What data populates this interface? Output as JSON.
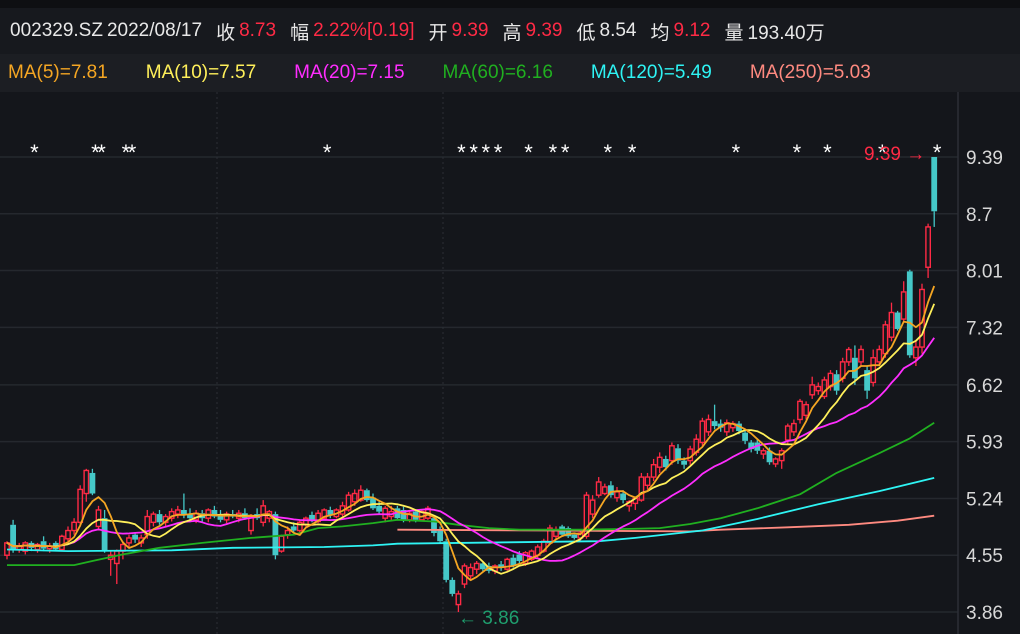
{
  "header": {
    "code": "002329.SZ",
    "date": "2022/08/17",
    "close_label": "收",
    "close": "8.73",
    "change_label": "幅",
    "change": "2.22%[0.19]",
    "open_label": "开",
    "open": "9.39",
    "high_label": "高",
    "high": "9.39",
    "low_label": "低",
    "low": "8.54",
    "avg_label": "均",
    "avg": "9.12",
    "volume_label": "量",
    "volume": "193.40万"
  },
  "ma_legend": [
    {
      "text": "MA(5)=7.81",
      "color": "#f5a623"
    },
    {
      "text": "MA(10)=7.57",
      "color": "#fff05a"
    },
    {
      "text": "MA(20)=7.15",
      "color": "#ff2dff"
    },
    {
      "text": "MA(60)=6.16",
      "color": "#20b020"
    },
    {
      "text": "MA(120)=5.49",
      "color": "#2ef4f4"
    },
    {
      "text": "MA(250)=5.03",
      "color": "#ff8a80"
    }
  ],
  "chart_data": {
    "type": "candlestick",
    "ylim": [
      3.86,
      9.39
    ],
    "y_ticks": [
      "9.39",
      "8.7",
      "8.01",
      "7.32",
      "6.62",
      "5.93",
      "5.24",
      "4.55",
      "3.86"
    ],
    "grid": true,
    "colors": {
      "up": "#ff2a45",
      "down": "#45c8c8",
      "max_label": "#ff2a45",
      "min_label": "#1f9e6e"
    },
    "max_label": "9.39",
    "min_label": "3.86",
    "star_marker": "*",
    "star_candles": [
      4,
      14,
      15,
      19,
      20,
      52,
      74,
      76,
      78,
      80,
      85,
      89,
      91,
      98,
      102,
      119,
      129,
      134,
      143,
      152
    ],
    "candles_ohlc": [
      [
        4.55,
        4.72,
        4.5,
        4.7
      ],
      [
        4.92,
        4.98,
        4.58,
        4.62
      ],
      [
        4.62,
        4.7,
        4.58,
        4.66
      ],
      [
        4.6,
        4.72,
        4.56,
        4.7
      ],
      [
        4.7,
        4.72,
        4.6,
        4.64
      ],
      [
        4.62,
        4.7,
        4.58,
        4.68
      ],
      [
        4.72,
        4.78,
        4.6,
        4.63
      ],
      [
        4.63,
        4.7,
        4.58,
        4.66
      ],
      [
        4.7,
        4.72,
        4.6,
        4.62
      ],
      [
        4.62,
        4.8,
        4.6,
        4.78
      ],
      [
        4.75,
        4.9,
        4.72,
        4.85
      ],
      [
        4.85,
        5.0,
        4.8,
        4.95
      ],
      [
        4.95,
        5.4,
        4.9,
        5.35
      ],
      [
        5.3,
        5.6,
        5.2,
        5.58
      ],
      [
        5.55,
        5.6,
        5.28,
        5.3
      ],
      [
        4.9,
        5.15,
        4.85,
        5.1
      ],
      [
        5.0,
        5.1,
        4.58,
        4.6
      ],
      [
        4.5,
        4.6,
        4.3,
        4.55
      ],
      [
        4.45,
        4.62,
        4.2,
        4.6
      ],
      [
        4.6,
        4.72,
        4.5,
        4.68
      ],
      [
        4.7,
        4.8,
        4.65,
        4.76
      ],
      [
        4.8,
        4.82,
        4.7,
        4.74
      ],
      [
        4.7,
        4.8,
        4.65,
        4.76
      ],
      [
        4.8,
        5.1,
        4.75,
        5.02
      ],
      [
        4.95,
        5.08,
        4.9,
        5.05
      ],
      [
        5.05,
        5.1,
        4.92,
        4.95
      ],
      [
        4.95,
        5.05,
        4.9,
        5.02
      ],
      [
        5.0,
        5.12,
        4.96,
        5.08
      ],
      [
        5.05,
        5.15,
        5.0,
        5.1
      ],
      [
        5.1,
        5.3,
        5.0,
        5.05
      ],
      [
        5.05,
        5.12,
        4.95,
        5.0
      ],
      [
        4.98,
        5.1,
        4.94,
        5.06
      ],
      [
        5.06,
        5.1,
        4.96,
        5.0
      ],
      [
        5.0,
        5.12,
        4.95,
        5.1
      ],
      [
        5.1,
        5.15,
        5.0,
        5.02
      ],
      [
        5.05,
        5.1,
        4.95,
        4.98
      ],
      [
        4.98,
        5.08,
        4.94,
        5.05
      ],
      [
        5.05,
        5.1,
        5.0,
        5.02
      ],
      [
        5.0,
        5.1,
        4.95,
        5.06
      ],
      [
        5.06,
        5.12,
        4.98,
        5.0
      ],
      [
        4.85,
        5.05,
        4.8,
        5.02
      ],
      [
        5.05,
        5.12,
        4.98,
        5.0
      ],
      [
        4.95,
        5.22,
        4.9,
        5.15
      ],
      [
        5.0,
        5.1,
        4.95,
        5.08
      ],
      [
        5.05,
        5.08,
        4.5,
        4.55
      ],
      [
        4.6,
        4.8,
        4.58,
        4.78
      ],
      [
        4.8,
        4.9,
        4.75,
        4.85
      ],
      [
        4.9,
        4.95,
        4.82,
        4.85
      ],
      [
        4.85,
        4.98,
        4.82,
        4.95
      ],
      [
        4.92,
        5.02,
        4.9,
        5.0
      ],
      [
        5.04,
        5.08,
        4.95,
        4.98
      ],
      [
        4.96,
        5.1,
        4.94,
        5.06
      ],
      [
        5.0,
        5.12,
        4.98,
        5.1
      ],
      [
        5.1,
        5.14,
        5.0,
        5.04
      ],
      [
        5.02,
        5.12,
        5.0,
        5.1
      ],
      [
        5.05,
        5.2,
        5.02,
        5.15
      ],
      [
        5.1,
        5.32,
        5.08,
        5.28
      ],
      [
        5.2,
        5.35,
        5.15,
        5.3
      ],
      [
        5.22,
        5.4,
        5.2,
        5.34
      ],
      [
        5.34,
        5.36,
        5.2,
        5.22
      ],
      [
        5.25,
        5.3,
        5.1,
        5.12
      ],
      [
        5.15,
        5.2,
        5.05,
        5.08
      ],
      [
        5.0,
        5.15,
        4.95,
        5.12
      ],
      [
        5.02,
        5.15,
        4.98,
        5.08
      ],
      [
        5.12,
        5.15,
        4.98,
        5.0
      ],
      [
        5.1,
        5.14,
        4.95,
        4.98
      ],
      [
        4.98,
        5.1,
        4.95,
        5.06
      ],
      [
        5.08,
        5.1,
        4.95,
        4.98
      ],
      [
        4.98,
        5.1,
        4.96,
        5.08
      ],
      [
        5.0,
        5.15,
        4.98,
        5.12
      ],
      [
        5.0,
        5.02,
        4.78,
        4.82
      ],
      [
        4.85,
        4.9,
        4.7,
        4.72
      ],
      [
        4.72,
        4.75,
        4.22,
        4.25
      ],
      [
        4.25,
        4.28,
        4.05,
        4.08
      ],
      [
        3.95,
        4.12,
        3.86,
        4.08
      ],
      [
        4.2,
        4.45,
        4.15,
        4.42
      ],
      [
        4.3,
        4.45,
        4.25,
        4.4
      ],
      [
        4.38,
        4.48,
        4.32,
        4.45
      ],
      [
        4.45,
        4.46,
        4.36,
        4.38
      ],
      [
        4.42,
        4.46,
        4.33,
        4.36
      ],
      [
        4.36,
        4.44,
        4.32,
        4.42
      ],
      [
        4.44,
        4.48,
        4.36,
        4.4
      ],
      [
        4.38,
        4.52,
        4.36,
        4.5
      ],
      [
        4.52,
        4.56,
        4.4,
        4.42
      ],
      [
        4.56,
        4.6,
        4.45,
        4.48
      ],
      [
        4.45,
        4.6,
        4.42,
        4.58
      ],
      [
        4.5,
        4.62,
        4.48,
        4.6
      ],
      [
        4.55,
        4.68,
        4.52,
        4.65
      ],
      [
        4.6,
        4.75,
        4.58,
        4.72
      ],
      [
        4.7,
        4.92,
        4.68,
        4.88
      ],
      [
        4.78,
        4.9,
        4.74,
        4.86
      ],
      [
        4.9,
        4.92,
        4.78,
        4.8
      ],
      [
        4.88,
        4.9,
        4.76,
        4.78
      ],
      [
        4.8,
        4.82,
        4.74,
        4.76
      ],
      [
        4.76,
        4.85,
        4.72,
        4.82
      ],
      [
        4.78,
        5.32,
        4.75,
        5.28
      ],
      [
        5.05,
        5.28,
        5.0,
        5.22
      ],
      [
        5.28,
        5.5,
        5.25,
        5.44
      ],
      [
        5.3,
        5.42,
        5.28,
        5.38
      ],
      [
        5.4,
        5.45,
        5.25,
        5.28
      ],
      [
        5.25,
        5.38,
        5.2,
        5.32
      ],
      [
        5.3,
        5.34,
        5.18,
        5.22
      ],
      [
        5.15,
        5.22,
        5.08,
        5.2
      ],
      [
        5.18,
        5.26,
        5.1,
        5.24
      ],
      [
        5.22,
        5.55,
        5.2,
        5.5
      ],
      [
        5.4,
        5.55,
        5.35,
        5.5
      ],
      [
        5.5,
        5.72,
        5.45,
        5.65
      ],
      [
        5.62,
        5.8,
        5.55,
        5.74
      ],
      [
        5.72,
        5.76,
        5.58,
        5.62
      ],
      [
        5.7,
        5.92,
        5.65,
        5.88
      ],
      [
        5.85,
        5.9,
        5.66,
        5.7
      ],
      [
        5.7,
        5.74,
        5.6,
        5.65
      ],
      [
        5.7,
        5.88,
        5.65,
        5.84
      ],
      [
        5.8,
        6.02,
        5.76,
        5.96
      ],
      [
        5.92,
        6.22,
        5.88,
        6.18
      ],
      [
        6.05,
        6.26,
        6.0,
        6.2
      ],
      [
        6.18,
        6.38,
        6.08,
        6.12
      ],
      [
        6.15,
        6.2,
        6.05,
        6.1
      ],
      [
        6.05,
        6.2,
        6.0,
        6.16
      ],
      [
        6.1,
        6.18,
        6.05,
        6.15
      ],
      [
        6.15,
        6.18,
        6.02,
        6.06
      ],
      [
        6.04,
        6.06,
        5.9,
        5.94
      ],
      [
        5.92,
        5.95,
        5.8,
        5.84
      ],
      [
        5.92,
        5.96,
        5.78,
        5.82
      ],
      [
        5.78,
        5.85,
        5.72,
        5.82
      ],
      [
        5.82,
        5.86,
        5.65,
        5.68
      ],
      [
        5.66,
        5.74,
        5.62,
        5.72
      ],
      [
        5.7,
        5.85,
        5.6,
        5.82
      ],
      [
        5.95,
        6.15,
        5.9,
        6.12
      ],
      [
        6.05,
        6.2,
        6.0,
        6.15
      ],
      [
        6.2,
        6.45,
        6.15,
        6.42
      ],
      [
        6.25,
        6.42,
        6.2,
        6.38
      ],
      [
        6.5,
        6.72,
        6.45,
        6.62
      ],
      [
        6.55,
        6.65,
        6.5,
        6.6
      ],
      [
        6.48,
        6.72,
        6.45,
        6.68
      ],
      [
        6.6,
        6.8,
        6.55,
        6.76
      ],
      [
        6.75,
        6.8,
        6.5,
        6.55
      ],
      [
        6.7,
        6.95,
        6.65,
        6.9
      ],
      [
        6.9,
        7.08,
        6.85,
        7.05
      ],
      [
        6.95,
        7.1,
        6.62,
        6.7
      ],
      [
        6.9,
        7.1,
        6.85,
        7.05
      ],
      [
        6.8,
        6.85,
        6.45,
        6.55
      ],
      [
        6.65,
        7.05,
        6.6,
        6.95
      ],
      [
        6.9,
        7.1,
        6.85,
        7.05
      ],
      [
        7.0,
        7.4,
        6.95,
        7.35
      ],
      [
        7.2,
        7.62,
        7.15,
        7.5
      ],
      [
        7.5,
        7.52,
        7.28,
        7.3
      ],
      [
        7.42,
        7.88,
        7.38,
        7.75
      ],
      [
        8.0,
        8.02,
        6.95,
        6.98
      ],
      [
        6.95,
        7.15,
        6.85,
        7.08
      ],
      [
        7.08,
        7.85,
        7.0,
        7.78
      ],
      [
        8.05,
        8.58,
        7.92,
        8.54
      ],
      [
        9.39,
        9.39,
        8.54,
        8.73
      ]
    ],
    "ma_series": [
      {
        "name": "MA(5)",
        "period": 5,
        "color": "#f5a623"
      },
      {
        "name": "MA(10)",
        "period": 10,
        "color": "#fff05a"
      },
      {
        "name": "MA(20)",
        "period": 20,
        "color": "#ff2dff"
      },
      {
        "name": "MA(60)",
        "color": "#20b020",
        "points": [
          [
            0,
            4.43
          ],
          [
            11,
            4.43
          ],
          [
            14,
            4.48
          ],
          [
            19,
            4.56
          ],
          [
            25,
            4.64
          ],
          [
            32,
            4.7
          ],
          [
            40,
            4.76
          ],
          [
            47,
            4.8
          ],
          [
            51,
            4.88
          ],
          [
            55,
            4.9
          ],
          [
            60,
            4.94
          ],
          [
            64,
            4.98
          ],
          [
            70,
            4.96
          ],
          [
            74,
            4.92
          ],
          [
            79,
            4.88
          ],
          [
            84,
            4.86
          ],
          [
            94,
            4.86
          ],
          [
            102,
            4.87
          ],
          [
            107,
            4.88
          ],
          [
            112,
            4.93
          ],
          [
            117,
            5.0
          ],
          [
            123,
            5.12
          ],
          [
            130,
            5.29
          ],
          [
            136,
            5.55
          ],
          [
            143,
            5.79
          ],
          [
            148,
            5.97
          ],
          [
            152,
            6.16
          ]
        ]
      },
      {
        "name": "MA(120)",
        "color": "#2ef4f4",
        "points": [
          [
            0,
            4.62
          ],
          [
            10,
            4.6
          ],
          [
            27,
            4.61
          ],
          [
            37,
            4.64
          ],
          [
            52,
            4.65
          ],
          [
            60,
            4.67
          ],
          [
            64,
            4.69
          ],
          [
            97,
            4.72
          ],
          [
            103,
            4.76
          ],
          [
            114,
            4.85
          ],
          [
            123,
            4.99
          ],
          [
            133,
            5.17
          ],
          [
            143,
            5.33
          ],
          [
            152,
            5.49
          ]
        ]
      },
      {
        "name": "MA(250)",
        "color": "#ff8a80",
        "points": [
          [
            64,
            4.86
          ],
          [
            88,
            4.85
          ],
          [
            112,
            4.84
          ],
          [
            117,
            4.86
          ],
          [
            128,
            4.89
          ],
          [
            138,
            4.92
          ],
          [
            146,
            4.97
          ],
          [
            152,
            5.03
          ]
        ]
      }
    ]
  }
}
